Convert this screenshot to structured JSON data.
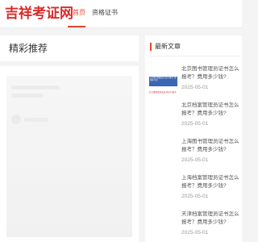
{
  "header": {
    "logo": "吉祥考证网",
    "nav": [
      {
        "label": "首页",
        "active": true
      },
      {
        "label": "资格证书",
        "active": false
      }
    ]
  },
  "featured": {
    "title": "精彩推荐"
  },
  "sidebar": {
    "title": "最新文章",
    "thumbnail": {
      "top_text": "北京图书管理员证书怎么报考? 费用多少钱?",
      "bottom_text": "北京图书管理员证书怎么报考"
    },
    "articles": [
      {
        "title": "北京图书管理员证书怎么报考？费用多少钱?",
        "date": "2025-05-01"
      },
      {
        "title": "北京档案管理员证书怎么报考？费用多少钱?",
        "date": "2025-05-01"
      },
      {
        "title": "上海图书管理员证书怎么报考？费用多少钱?",
        "date": "2025-05-01"
      },
      {
        "title": "上海档案管理员证书怎么报考？费用多少钱?",
        "date": "2025-05-01"
      },
      {
        "title": "天津档案管理员证书怎么报考？费用多少钱?",
        "date": "2025-05-01"
      }
    ]
  },
  "colors": {
    "brand": "#d92b2b",
    "accent": "#e8452e",
    "background": "#f4f4f4"
  }
}
